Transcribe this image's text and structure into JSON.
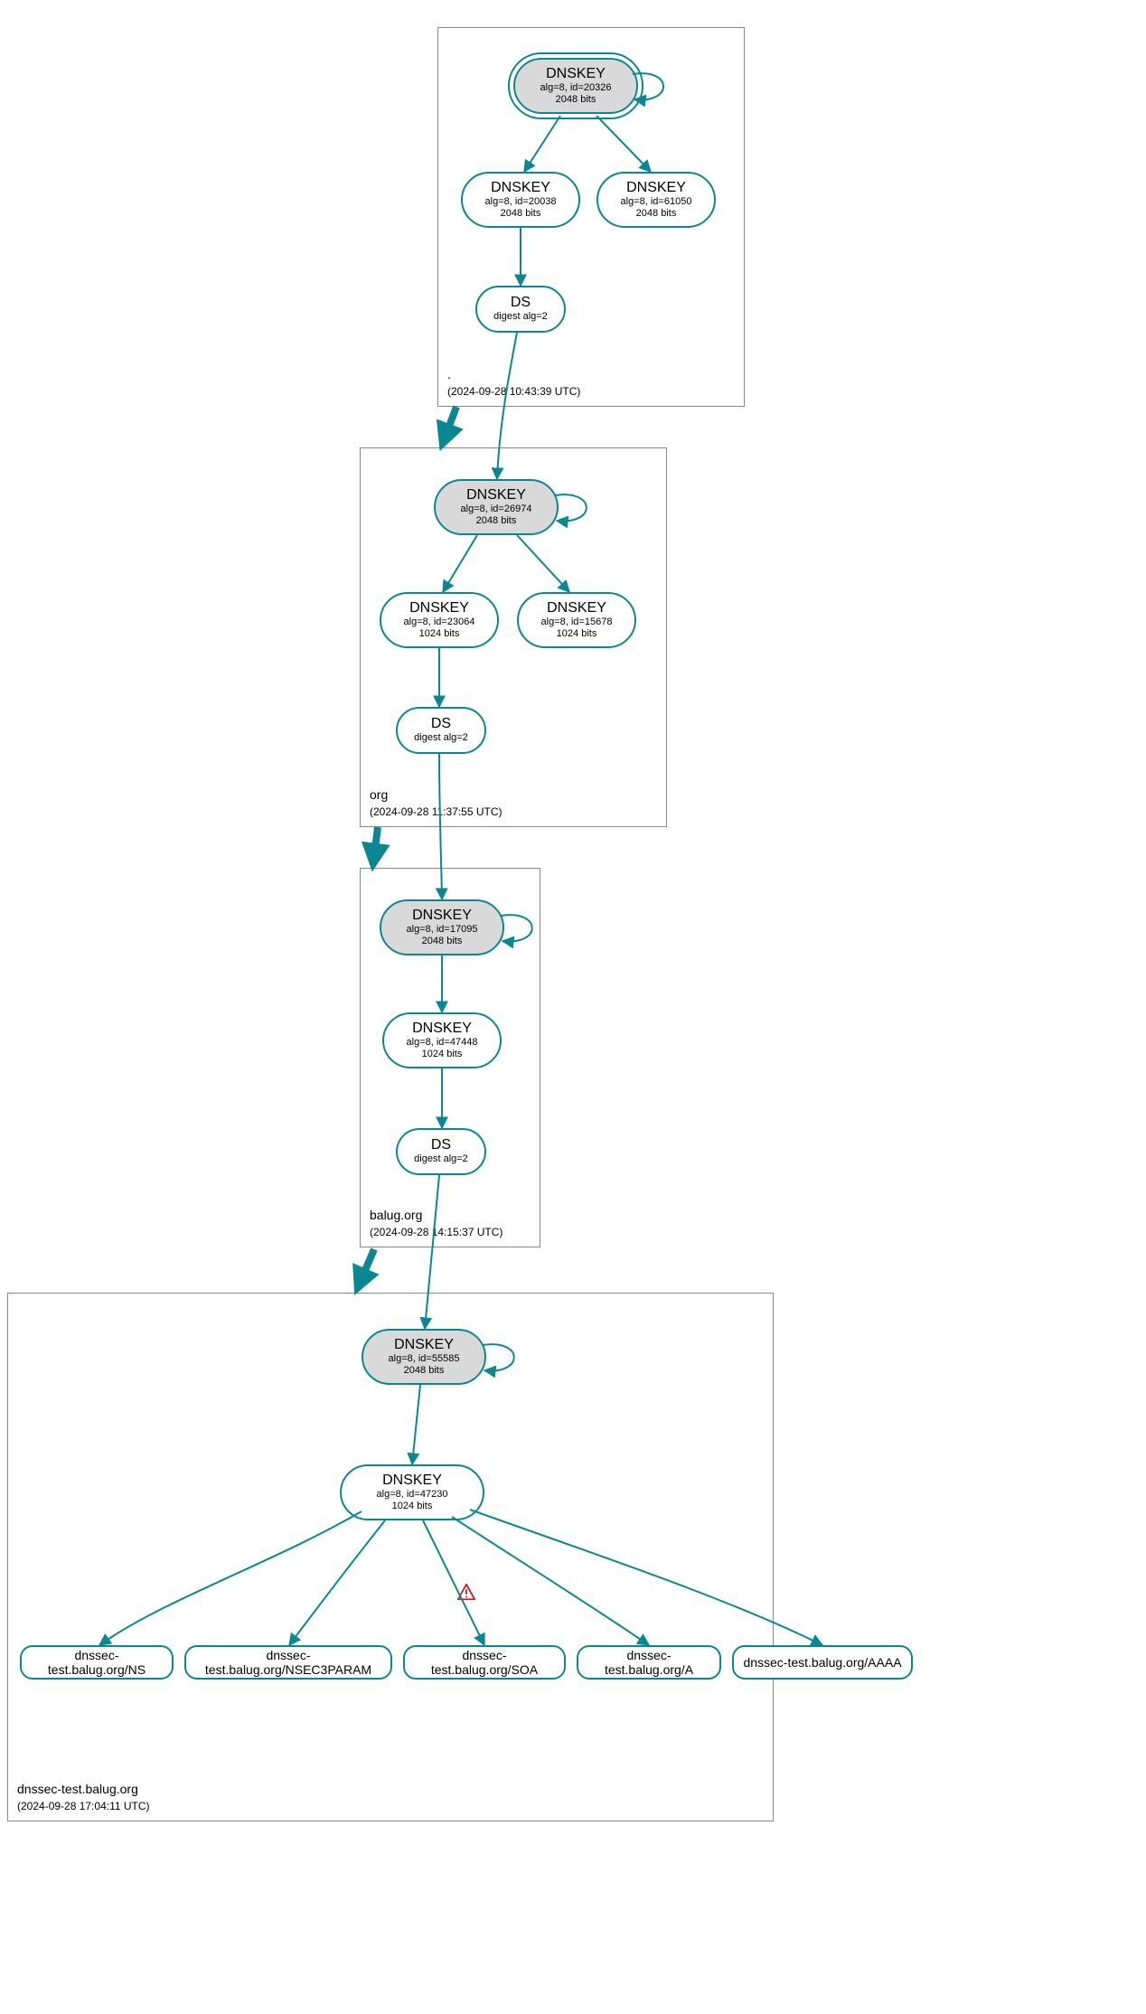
{
  "colors": {
    "teal": "#0b8793",
    "node_fill_ksk": "#d9d9d9",
    "warn_border": "#c62828",
    "warn_fill": "#ffffff",
    "warn_bang": "#c62828"
  },
  "zones": [
    {
      "id": "root",
      "name": ".",
      "timestamp": "(2024-09-28 10:43:39 UTC)",
      "nodes": [
        {
          "id": "root_ksk",
          "type": "DNSKEY",
          "role": "ksk",
          "alg": "alg=8, id=20326",
          "bits": "2048 bits"
        },
        {
          "id": "root_zsk1",
          "type": "DNSKEY",
          "role": "zsk",
          "alg": "alg=8, id=20038",
          "bits": "2048 bits"
        },
        {
          "id": "root_zsk2",
          "type": "DNSKEY",
          "role": "zsk",
          "alg": "alg=8, id=61050",
          "bits": "2048 bits"
        },
        {
          "id": "root_ds",
          "type": "DS",
          "role": "ds",
          "alg": "digest alg=2",
          "bits": ""
        }
      ],
      "edges": [
        [
          "root_ksk",
          "root_ksk",
          "self"
        ],
        [
          "root_ksk",
          "root_zsk1",
          "sig"
        ],
        [
          "root_ksk",
          "root_zsk2",
          "sig"
        ],
        [
          "root_zsk1",
          "root_ds",
          "sig"
        ]
      ]
    },
    {
      "id": "org",
      "name": "org",
      "timestamp": "(2024-09-28 11:37:55 UTC)",
      "nodes": [
        {
          "id": "org_ksk",
          "type": "DNSKEY",
          "role": "ksk",
          "alg": "alg=8, id=26974",
          "bits": "2048 bits"
        },
        {
          "id": "org_zsk1",
          "type": "DNSKEY",
          "role": "zsk",
          "alg": "alg=8, id=23064",
          "bits": "1024 bits"
        },
        {
          "id": "org_zsk2",
          "type": "DNSKEY",
          "role": "zsk",
          "alg": "alg=8, id=15678",
          "bits": "1024 bits"
        },
        {
          "id": "org_ds",
          "type": "DS",
          "role": "ds",
          "alg": "digest alg=2",
          "bits": ""
        }
      ],
      "edges": [
        [
          "org_ksk",
          "org_ksk",
          "self"
        ],
        [
          "org_ksk",
          "org_zsk1",
          "sig"
        ],
        [
          "org_ksk",
          "org_zsk2",
          "sig"
        ],
        [
          "org_zsk1",
          "org_ds",
          "sig"
        ]
      ]
    },
    {
      "id": "balug",
      "name": "balug.org",
      "timestamp": "(2024-09-28 14:15:37 UTC)",
      "nodes": [
        {
          "id": "balug_ksk",
          "type": "DNSKEY",
          "role": "ksk",
          "alg": "alg=8, id=17095",
          "bits": "2048 bits"
        },
        {
          "id": "balug_zsk",
          "type": "DNSKEY",
          "role": "zsk",
          "alg": "alg=8, id=47448",
          "bits": "1024 bits"
        },
        {
          "id": "balug_ds",
          "type": "DS",
          "role": "ds",
          "alg": "digest alg=2",
          "bits": ""
        }
      ],
      "edges": [
        [
          "balug_ksk",
          "balug_ksk",
          "self"
        ],
        [
          "balug_ksk",
          "balug_zsk",
          "sig"
        ],
        [
          "balug_zsk",
          "balug_ds",
          "sig"
        ]
      ]
    },
    {
      "id": "dnssec_test",
      "name": "dnssec-test.balug.org",
      "timestamp": "(2024-09-28 17:04:11 UTC)",
      "nodes": [
        {
          "id": "dt_ksk",
          "type": "DNSKEY",
          "role": "ksk",
          "alg": "alg=8, id=55585",
          "bits": "2048 bits"
        },
        {
          "id": "dt_zsk",
          "type": "DNSKEY",
          "role": "zsk",
          "alg": "alg=8, id=47230",
          "bits": "1024 bits"
        }
      ],
      "edges": [
        [
          "dt_ksk",
          "dt_ksk",
          "self"
        ],
        [
          "dt_ksk",
          "dt_zsk",
          "sig"
        ]
      ],
      "rrsets": [
        "dnssec-test.balug.org/NS",
        "dnssec-test.balug.org/NSEC3PARAM",
        "dnssec-test.balug.org/SOA",
        "dnssec-test.balug.org/A",
        "dnssec-test.balug.org/AAAA"
      ],
      "rrset_edges_from": "dt_zsk",
      "warning_on_edge_index": 2
    }
  ],
  "delegations": [
    [
      "root_ds",
      "org_ksk"
    ],
    [
      "org_ds",
      "balug_ksk"
    ],
    [
      "balug_ds",
      "dt_ksk"
    ]
  ],
  "zone_corner_arrows": [
    [
      "root",
      "org"
    ],
    [
      "org",
      "balug"
    ],
    [
      "balug",
      "dnssec_test"
    ]
  ]
}
